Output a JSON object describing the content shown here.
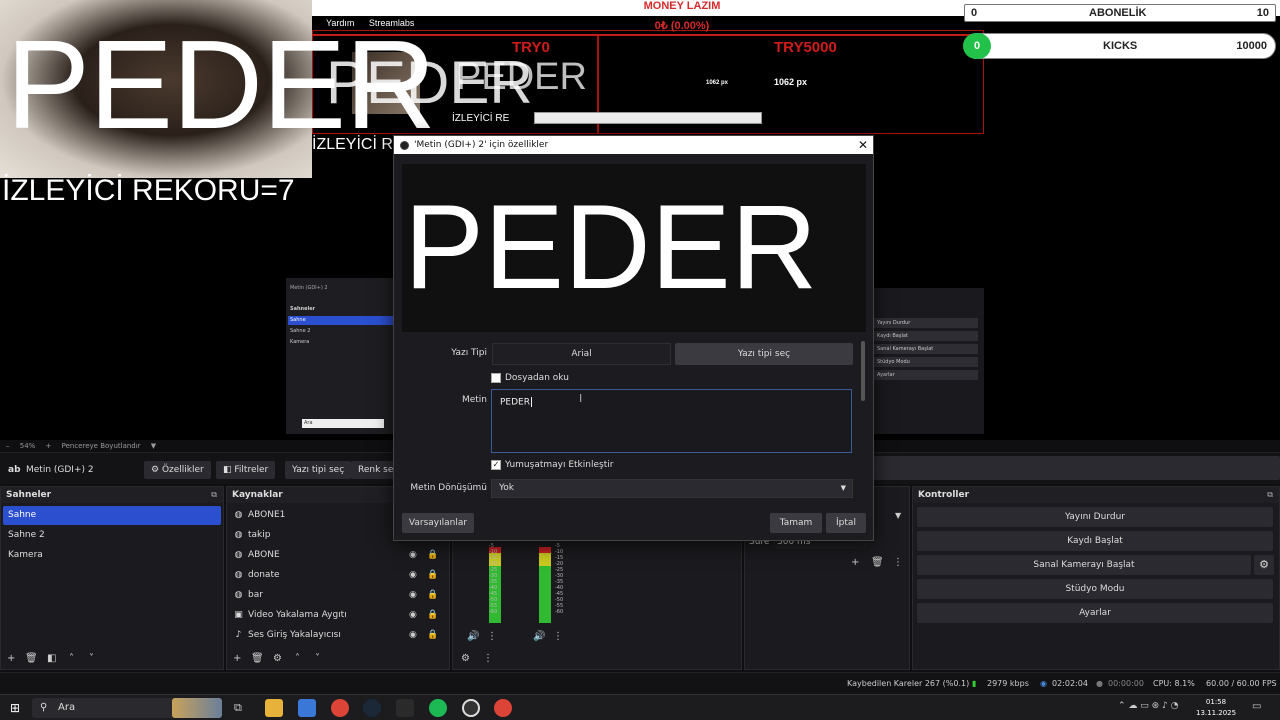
{
  "preview": {
    "big_text": "PEDER",
    "record_text": "İZLEYİCİ REKORU=7",
    "money_title": "MONEY LAZIM",
    "money_value": "0₺ (0.00%)",
    "try_left": "TRY0",
    "try_right": "TRY5000",
    "subs_label": "ABONELİK",
    "subs_left": "0",
    "subs_right": "10",
    "kicks_label": "KICKS",
    "kicks_left": "0",
    "kicks_right": "10000",
    "mini_menu": [
      "Yardım",
      "Streamlabs"
    ],
    "mini_record": "İZLEYİCİ REK",
    "mini_px": "1062 px",
    "mini_small_text": "İZLEYİCİ RE",
    "deep_scenes_header": "Sahneler",
    "deep_scenes": [
      "Sahne",
      "Sahne 2",
      "Kamera"
    ],
    "deep_controls": [
      "Yayını Durdur",
      "Kaydı Başlat",
      "Sanal Kamerayı Başlat",
      "Stüdyo Modu",
      "Ayarlar"
    ],
    "deep_source_title": "Metin (GDI+) 2",
    "deep_search": "Ara"
  },
  "dialog": {
    "title": "'Metin (GDI+) 2' için özellikler",
    "preview_text": "PEDER",
    "font_label": "Yazı Tipi",
    "font_name": "Arial",
    "font_button": "Yazı tipi seç",
    "from_file_label": "Dosyadan oku",
    "from_file_checked": false,
    "text_label": "Metin",
    "text_value": "PEDER",
    "antialias_label": "Yumuşatmayı Etkinleştir",
    "antialias_checked": true,
    "transform_label": "Metin Dönüşümü",
    "transform_value": "Yok",
    "defaults_button": "Varsayılanlar",
    "ok_button": "Tamam",
    "cancel_button": "İptal"
  },
  "zoom_bar": {
    "zoom": "54%",
    "fit": "Pencereye Boyutlandır"
  },
  "source_toolbar": {
    "source_name": "Metin (GDI+) 2",
    "properties": "Özellikler",
    "filters": "Filtreler",
    "select_font": "Yazı tipi seç",
    "text_color": "Renk seç"
  },
  "scenes": {
    "title": "Sahneler",
    "items": [
      "Sahne",
      "Sahne 2",
      "Kamera"
    ],
    "selected": 0
  },
  "sources": {
    "title": "Kaynaklar",
    "items": [
      {
        "name": "ABONE1",
        "icon": "globe-icon"
      },
      {
        "name": "takip",
        "icon": "globe-icon"
      },
      {
        "name": "ABONE",
        "icon": "globe-icon"
      },
      {
        "name": "donate",
        "icon": "globe-icon"
      },
      {
        "name": "bar",
        "icon": "globe-icon"
      },
      {
        "name": "Video Yakalama Aygıtı",
        "icon": "camera-icon"
      },
      {
        "name": "Ses Giriş Yakalayıcısı",
        "icon": "microphone-icon"
      }
    ]
  },
  "mixer": {
    "scale": [
      "-5",
      "-10",
      "-15",
      "-20",
      "-25",
      "-30",
      "-35",
      "-40",
      "-45",
      "-50",
      "-55",
      "-60"
    ]
  },
  "transitions": {
    "duration_label": "Süre",
    "duration_value": "300 ms"
  },
  "controls": {
    "title": "Kontroller",
    "buttons": [
      "Yayını Durdur",
      "Kaydı Başlat",
      "Sanal Kamerayı Başlat",
      "Stüdyo Modu",
      "Ayarlar"
    ]
  },
  "status": {
    "dropped": "Kaybedilen Kareler 267 (%0.1)",
    "bitrate": "2979 kbps",
    "live_time": "02:02:04",
    "rec_time": "00:00:00",
    "cpu": "CPU: 8.1%",
    "fps": "60.00 / 60.00 FPS"
  },
  "taskbar": {
    "search": "Ara",
    "time": "01:58",
    "date": "13.11.2025"
  },
  "colors": {
    "accent_blue": "#2b4fcf",
    "money_red": "#d72a2a",
    "kicks_green": "#22c24a"
  }
}
